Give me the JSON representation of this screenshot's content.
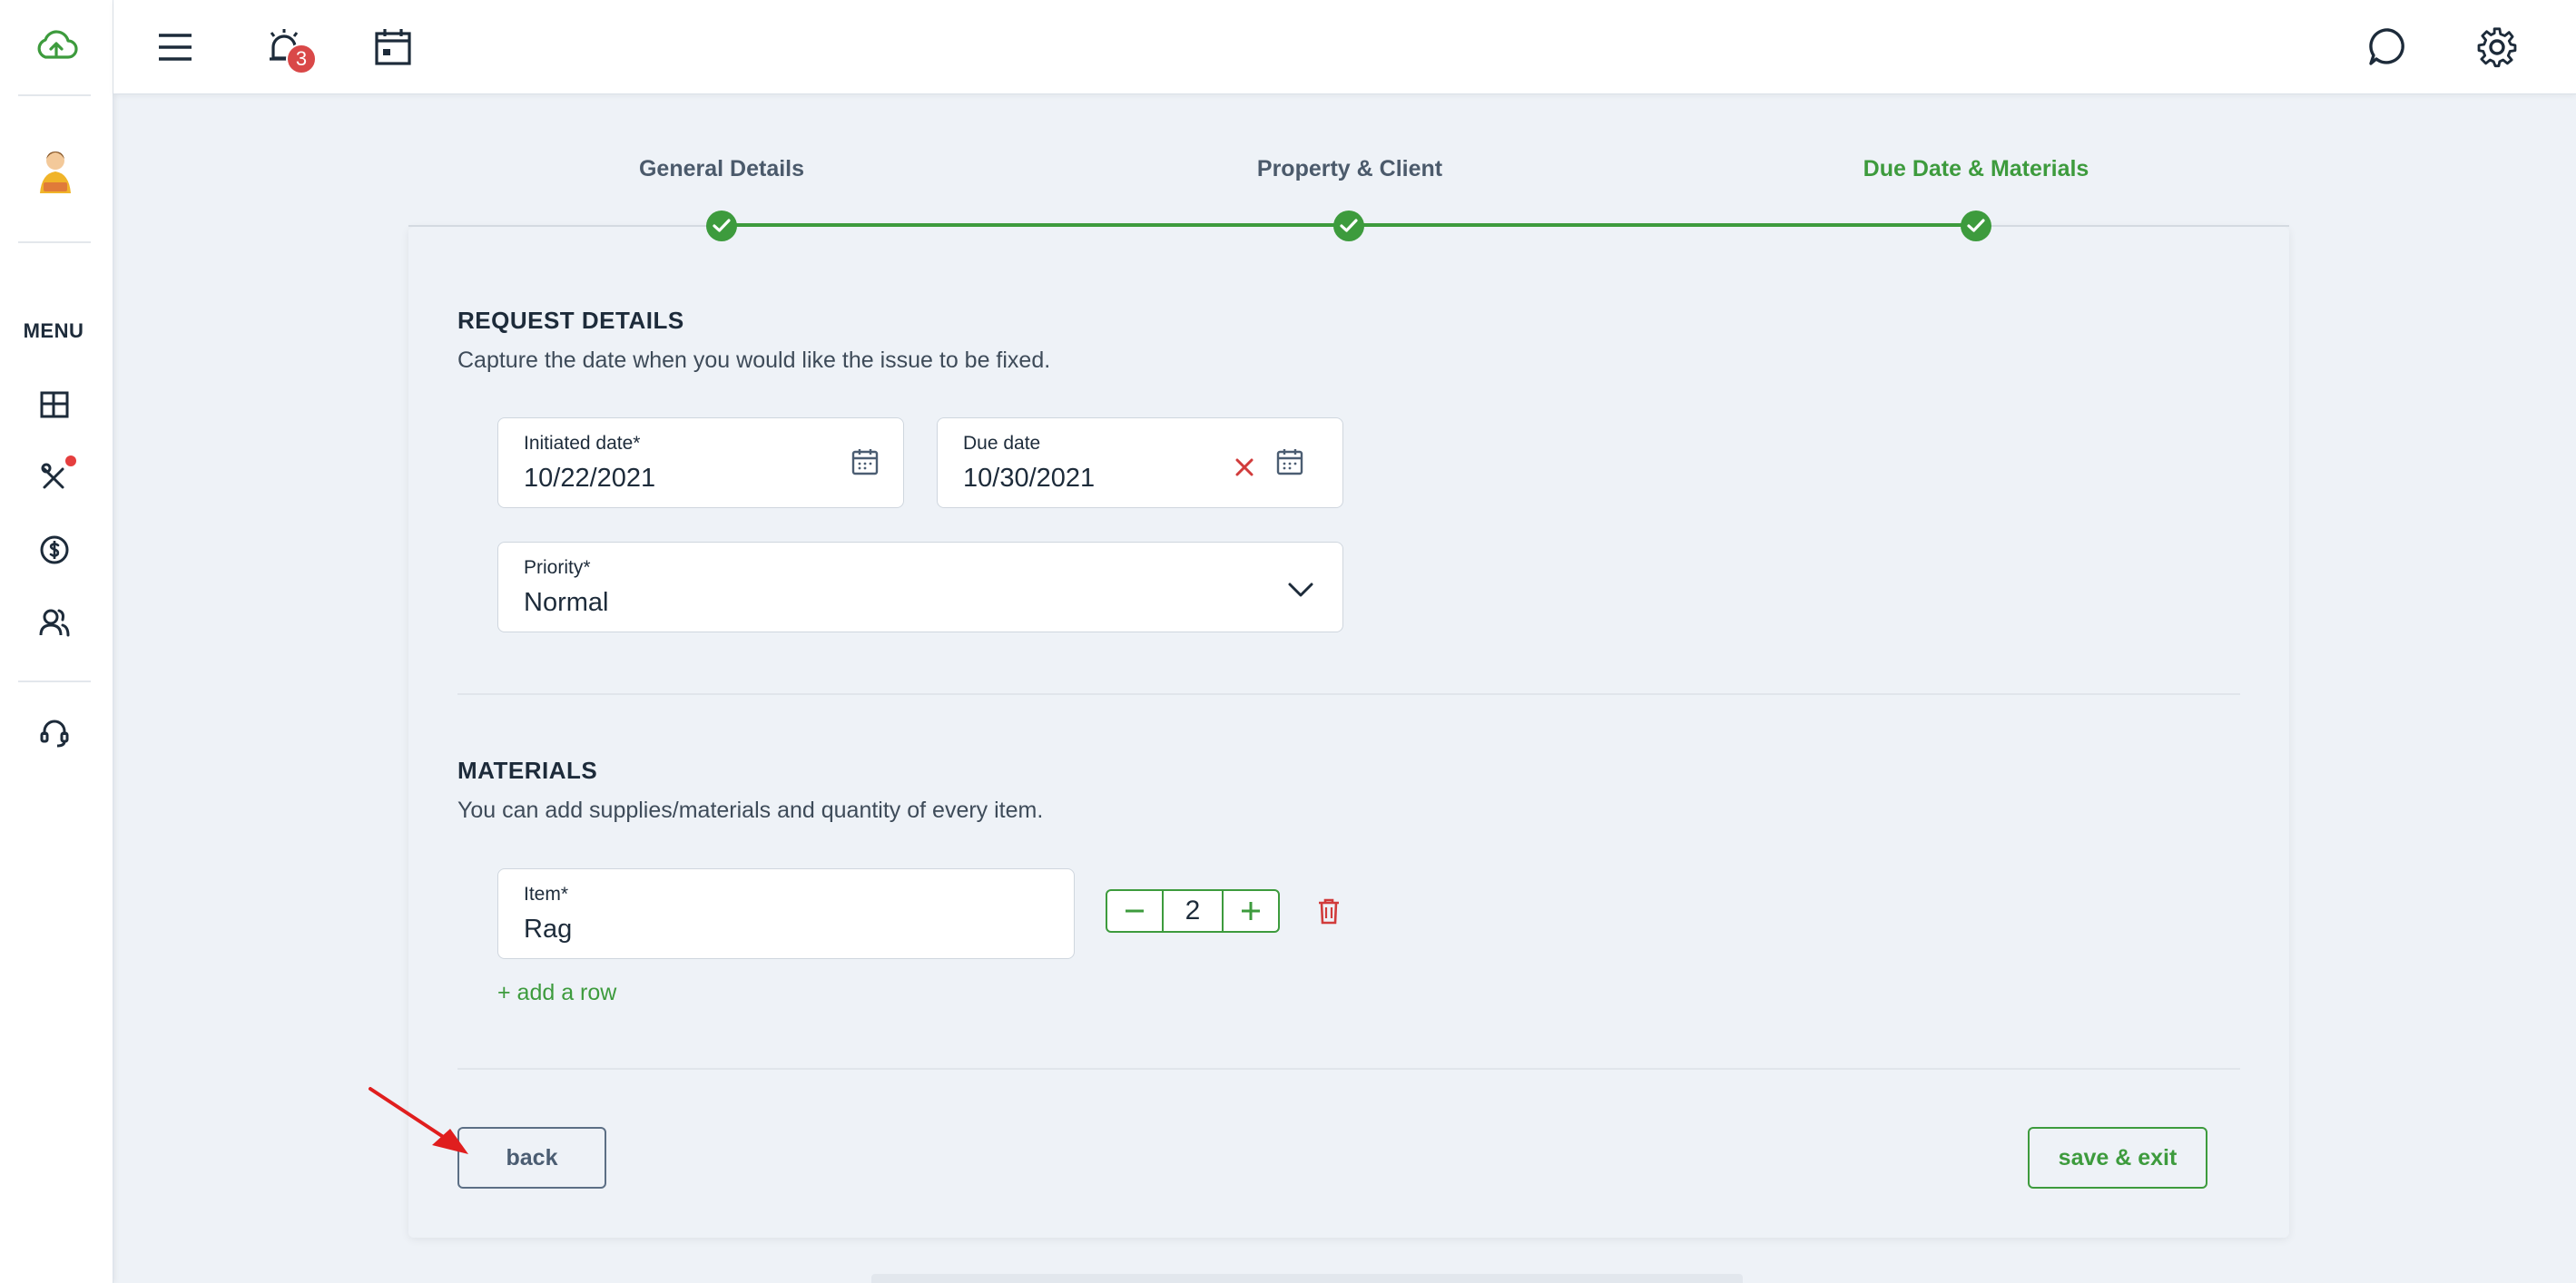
{
  "colors": {
    "accent": "#3d9b3d",
    "danger": "#d94848",
    "text": "#1d2b3a"
  },
  "sidebar": {
    "logo_icon": "cloud-upload-icon",
    "menu_label": "MENU",
    "items": [
      {
        "icon": "dashboard-icon"
      },
      {
        "icon": "tools-icon",
        "has_dot": true
      },
      {
        "icon": "dollar-icon"
      },
      {
        "icon": "users-icon"
      },
      {
        "icon": "headset-icon"
      }
    ]
  },
  "topbar": {
    "notifications_count": "3",
    "icons": [
      "hamburger-menu-icon",
      "alarm-bell-icon",
      "calendar-icon",
      "chat-icon",
      "gear-icon"
    ]
  },
  "stepper": {
    "steps": [
      {
        "label": "General Details",
        "done": true
      },
      {
        "label": "Property & Client",
        "done": true
      },
      {
        "label": "Due Date & Materials",
        "done": true,
        "active": true
      }
    ]
  },
  "request_details": {
    "title": "REQUEST DETAILS",
    "description": "Capture the date when you would like the issue to be fixed.",
    "initiated_date": {
      "label": "Initiated date*",
      "value": "10/22/2021"
    },
    "due_date": {
      "label": "Due date",
      "value": "10/30/2021"
    },
    "priority": {
      "label": "Priority*",
      "value": "Normal"
    }
  },
  "materials": {
    "title": "MATERIALS",
    "description": "You can add supplies/materials and quantity of every item.",
    "items": [
      {
        "label": "Item*",
        "value": "Rag",
        "quantity": "2"
      }
    ],
    "add_row_label": "+ add a row"
  },
  "footer": {
    "back_label": "back",
    "save_label": "save & exit"
  }
}
